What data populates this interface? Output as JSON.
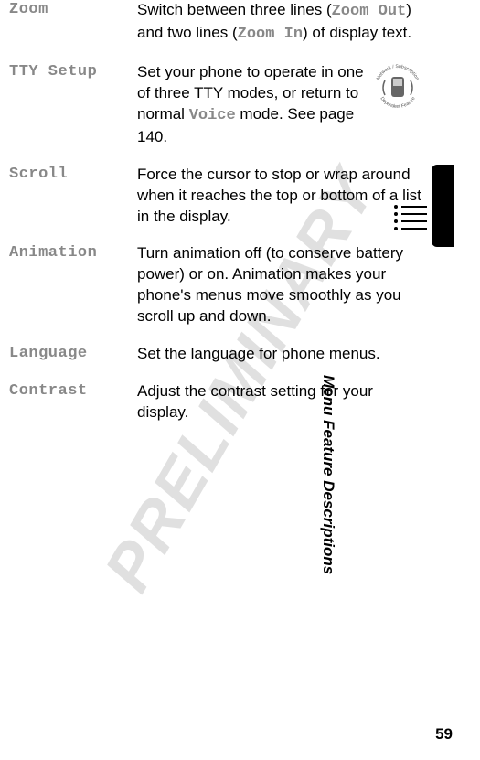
{
  "watermark": "PRELIMINARY",
  "rows": [
    {
      "label": "Zoom",
      "desc_pre": "Switch between three lines (",
      "mono1": "Zoom Out",
      "desc_mid": ") and two lines (",
      "mono2": "Zoom In",
      "desc_post": ") of display text."
    },
    {
      "label": "TTY Setup",
      "desc_pre": "Set your phone to operate in one of three TTY modes, or return to normal ",
      "mono1": "Voice",
      "desc_post": " mode. See page 140."
    },
    {
      "label": "Scroll",
      "desc": "Force the cursor to stop or wrap around when it reaches the top or bottom of a list in the display."
    },
    {
      "label": "Animation",
      "desc": "Turn animation off (to conserve battery power) or on. Animation makes your phone's menus move smoothly as you scroll up and down."
    },
    {
      "label": "Language",
      "desc": "Set the language for phone menus."
    },
    {
      "label": "Contrast",
      "desc": "Adjust the contrast setting for your display."
    }
  ],
  "side_title": "Menu Feature Descriptions",
  "page_number": "59",
  "feature_badge": {
    "top_text": "Network / Subscription",
    "bottom_text": "Dependent Feature"
  }
}
